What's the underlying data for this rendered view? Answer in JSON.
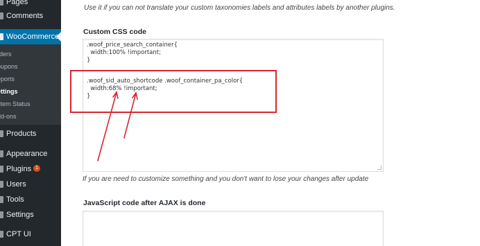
{
  "sidebar": {
    "items_top": [
      {
        "label": "Pages",
        "icon": "pages-icon"
      },
      {
        "label": "Comments",
        "icon": "comments-icon"
      }
    ],
    "active": {
      "label": "WooCommerce",
      "icon": "woocommerce-icon"
    },
    "submenu": [
      {
        "label": "Orders",
        "visible_text": "rders"
      },
      {
        "label": "Coupons",
        "visible_text": "oupons"
      },
      {
        "label": "Reports",
        "visible_text": "eports"
      },
      {
        "label": "Settings",
        "visible_text": "ettings",
        "current": true
      },
      {
        "label": "System Status",
        "visible_text": "stem Status"
      },
      {
        "label": "Add-ons",
        "visible_text": "dd-ons"
      }
    ],
    "items_bottom": [
      {
        "label": "Products",
        "icon": "products-icon"
      },
      {
        "label": "Appearance",
        "icon": "appearance-icon"
      },
      {
        "label": "Plugins",
        "icon": "plugins-icon",
        "badge": "1"
      },
      {
        "label": "Users",
        "icon": "users-icon"
      },
      {
        "label": "Tools",
        "icon": "tools-icon"
      },
      {
        "label": "Settings",
        "icon": "settings-icon"
      },
      {
        "label": "CPT UI",
        "icon": "cpt-ui-icon"
      }
    ]
  },
  "main": {
    "top_help": "Use it if you can not translate your custom taxonomies labels and attributes labels by another plugins.",
    "css_section": {
      "title": "Custom CSS code",
      "lines": [
        ".woof_price_search_container{",
        "  width:100% !important;",
        "}",
        "",
        ".woof_sid_auto_shortcode .woof_container_pa_color{",
        "  width:68% !important;",
        "}"
      ],
      "help": "If you are need to customize something and you don't want to lose your changes after update"
    },
    "js_section": {
      "title": "JavaScript code after AJAX is done",
      "value": ""
    }
  },
  "annotations": {
    "highlight_color": "#d9252e",
    "arrow_color": "#d9252e"
  }
}
